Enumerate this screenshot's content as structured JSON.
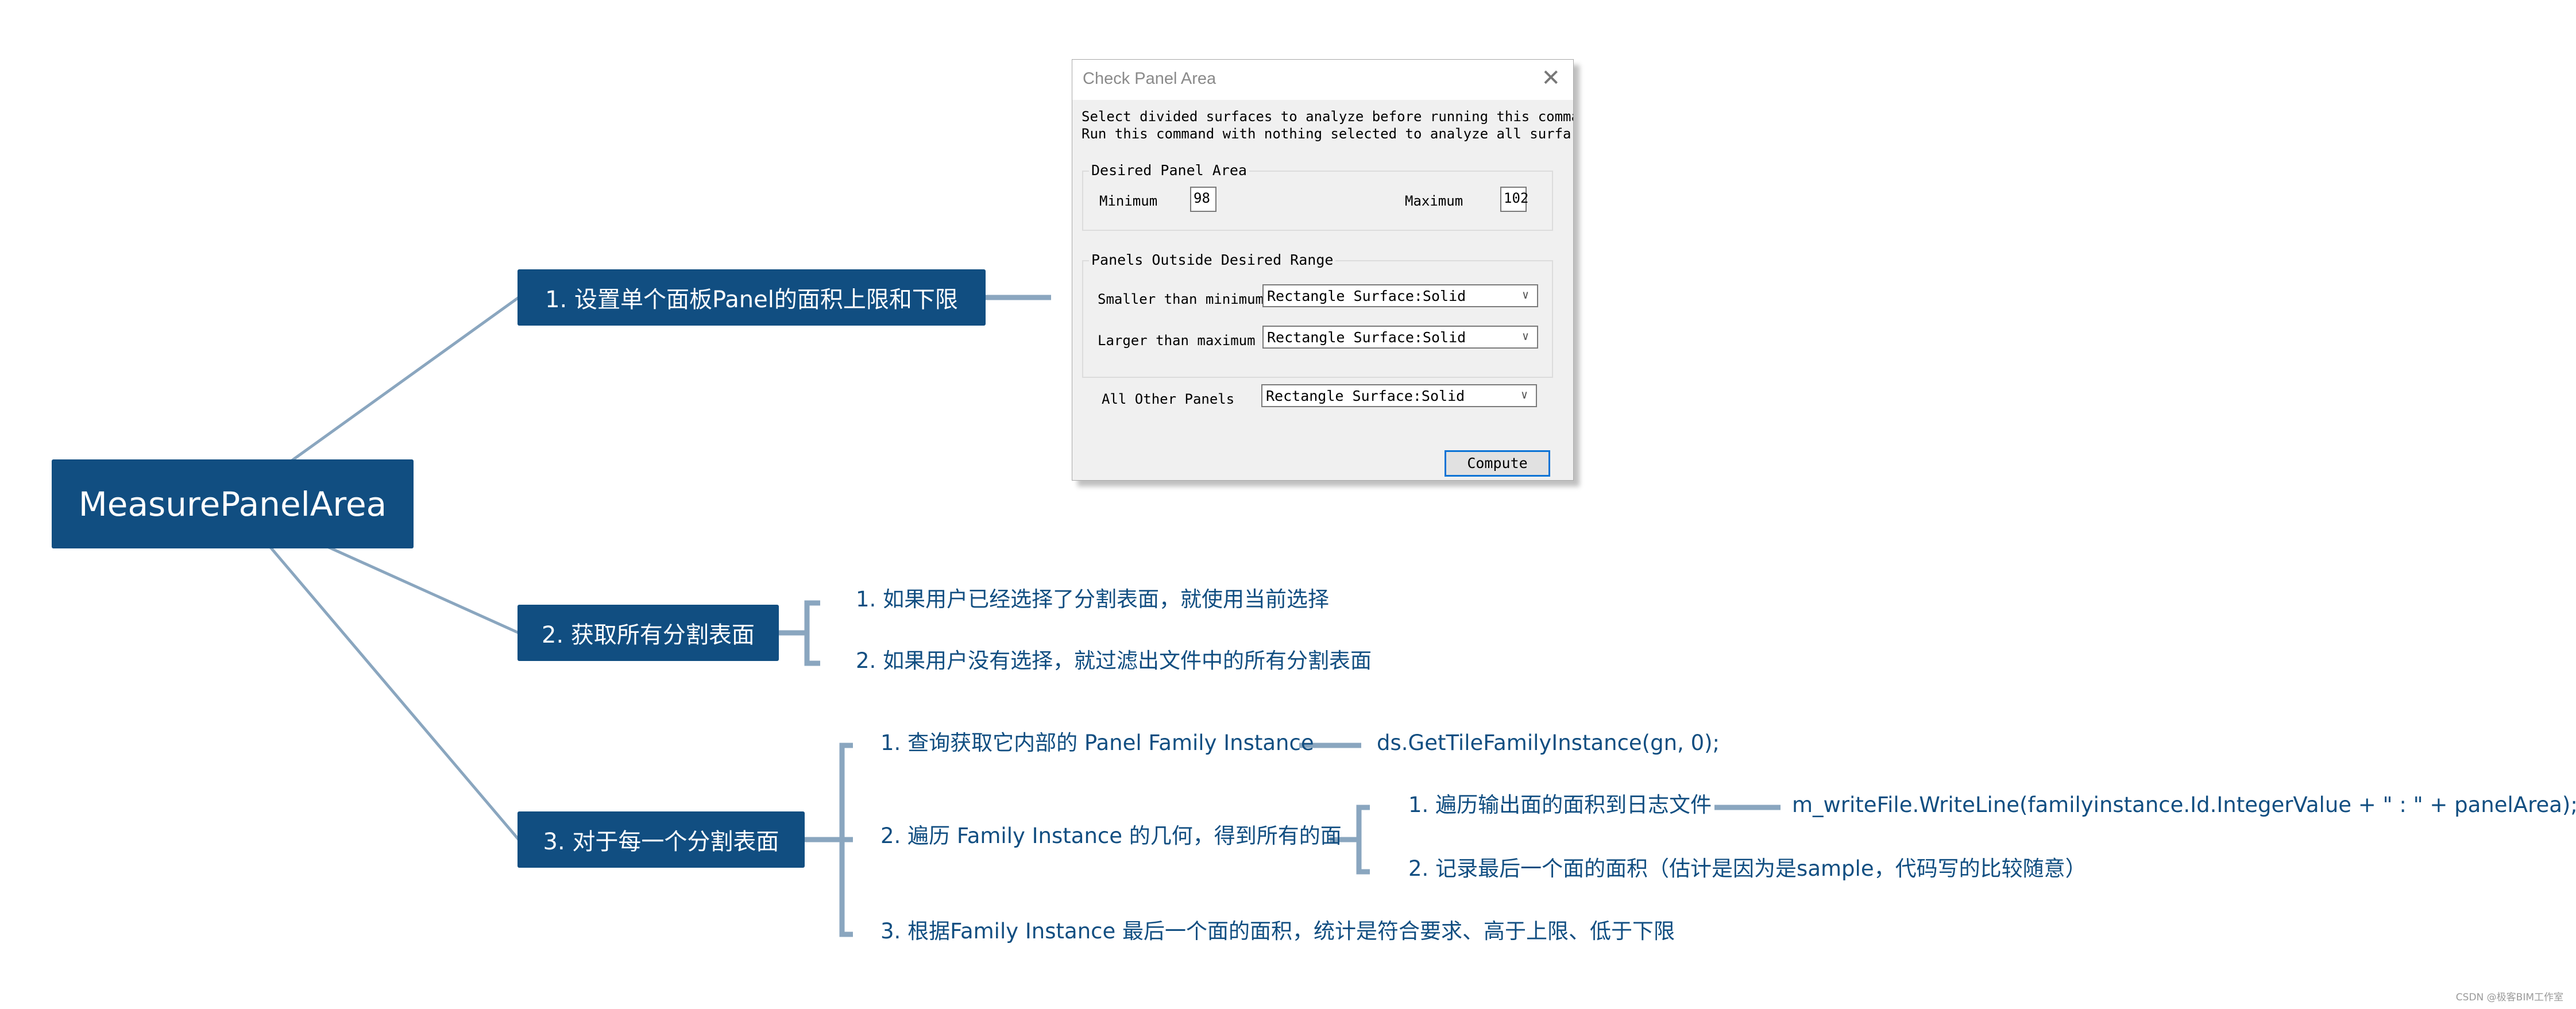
{
  "colors": {
    "node_fill": "#114e81",
    "node_text": "#ffffff",
    "leaf_text": "#114e81",
    "connector": "#8aa6bf",
    "focus_border": "#0a73d5"
  },
  "mindmap": {
    "root": "MeasurePanelArea",
    "branches": [
      {
        "label": "1. 设置单个面板Panel的面积上限和下限"
      },
      {
        "label": "2. 获取所有分割表面",
        "children": [
          "1. 如果用户已经选择了分割表面，就使用当前选择",
          "2. 如果用户没有选择，就过滤出文件中的所有分割表面"
        ]
      },
      {
        "label": "3. 对于每一个分割表面",
        "children": [
          {
            "label": "1. 查询获取它内部的 Panel Family Instance",
            "detail": "ds.GetTileFamilyInstance(gn, 0);"
          },
          {
            "label": "2. 遍历 Family Instance 的几何，得到所有的面",
            "children": [
              {
                "label": "1. 遍历输出面的面积到日志文件",
                "detail": "m_writeFile.WriteLine(familyinstance.Id.IntegerValue + \" : \" + panelArea);"
              },
              {
                "label": "2. 记录最后一个面的面积（估计是因为是sample，代码写的比较随意）"
              }
            ]
          },
          {
            "label": "3. 根据Family Instance 最后一个面的面积，统计是符合要求、高于上限、低于下限"
          }
        ]
      }
    ]
  },
  "dialog": {
    "title": "Check Panel Area",
    "close_icon": "close-icon",
    "description_line1": "Select divided surfaces to analyze before running this comma",
    "description_line2": "Run this command with nothing selected to analyze all surfa",
    "desired_group": {
      "title": "Desired Panel Area",
      "minimum_label": "Minimum",
      "minimum_value": "98",
      "maximum_label": "Maximum",
      "maximum_value": "102"
    },
    "outside_group": {
      "title": "Panels Outside Desired Range",
      "smaller_label": "Smaller than minimum",
      "smaller_value": "Rectangle Surface:Solid",
      "larger_label": "Larger than maximum",
      "larger_value": "Rectangle Surface:Solid"
    },
    "other_label": "All Other Panels",
    "other_value": "Rectangle Surface:Solid",
    "compute_label": "Compute"
  },
  "watermark": "CSDN @极客BIM工作室"
}
